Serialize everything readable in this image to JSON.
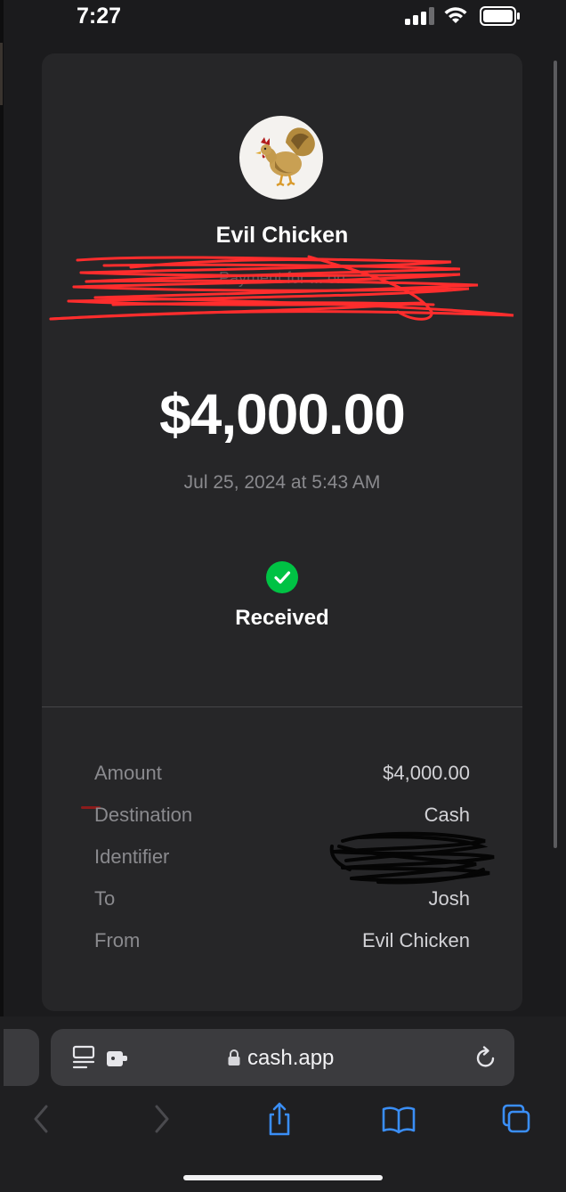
{
  "status_bar": {
    "time": "7:27",
    "signal_icon": "cellular-signal-icon",
    "wifi_icon": "wifi-icon",
    "battery_icon": "battery-icon"
  },
  "transaction": {
    "avatar_icon": "rooster-avatar-icon",
    "name": "Evil Chicken",
    "redacted_note": "Payment for ... on",
    "amount": "$4,000.00",
    "datetime": "Jul 25, 2024 at 5:43 AM",
    "status_icon": "check-circle-icon",
    "status": "Received",
    "details": [
      {
        "label": "Amount",
        "value": "$4,000.00"
      },
      {
        "label": "Destination",
        "value": "Cash"
      },
      {
        "label": "Identifier",
        "value": ""
      },
      {
        "label": "To",
        "value": "Josh"
      },
      {
        "label": "From",
        "value": "Evil Chicken"
      }
    ]
  },
  "browser": {
    "url": "cash.app",
    "reader_icon": "reader-view-icon",
    "extension_icon": "extension-icon",
    "lock_icon": "lock-icon",
    "reload_icon": "reload-icon",
    "toolbar": {
      "back_icon": "back-chevron-icon",
      "forward_icon": "forward-chevron-icon",
      "share_icon": "share-icon",
      "bookmarks_icon": "bookmarks-icon",
      "tabs_icon": "tabs-icon"
    }
  },
  "colors": {
    "background": "#1b1b1d",
    "card": "#262628",
    "success_green": "#00c244",
    "accent_blue": "#3a8ef6",
    "muted_text": "#8a8a8e"
  }
}
